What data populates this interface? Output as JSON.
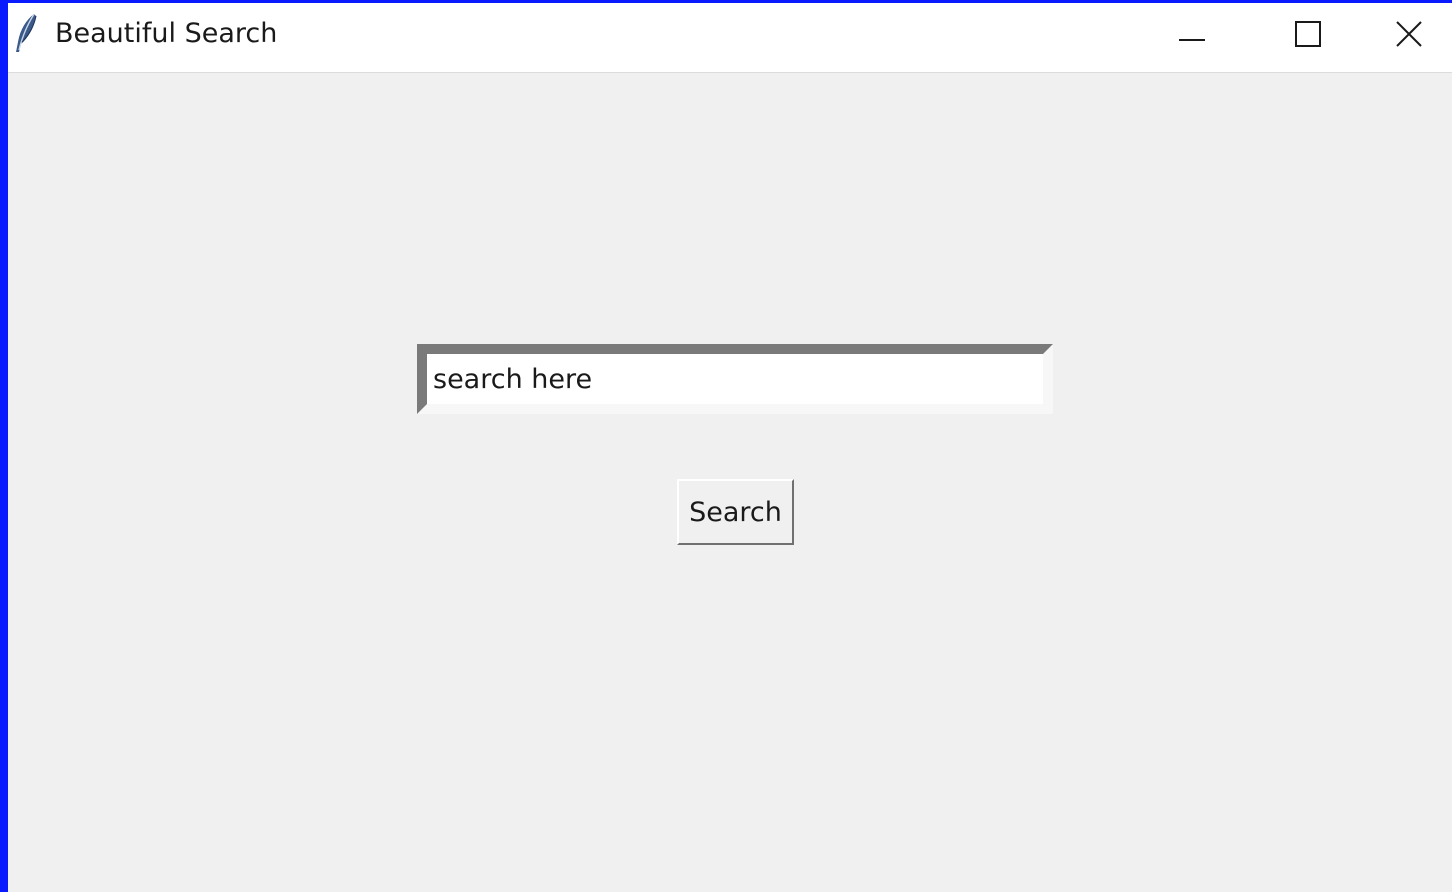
{
  "window": {
    "title": "Beautiful Search",
    "app_icon": "feather-icon",
    "controls": {
      "minimize_icon": "minimize-icon",
      "maximize_icon": "maximize-icon",
      "close_icon": "close-icon"
    }
  },
  "search": {
    "input_value": "search here",
    "button_label": "Search"
  },
  "colors": {
    "desktop_background": "#0a1aff",
    "window_background": "#f0f0f0",
    "titlebar_background": "#ffffff"
  }
}
